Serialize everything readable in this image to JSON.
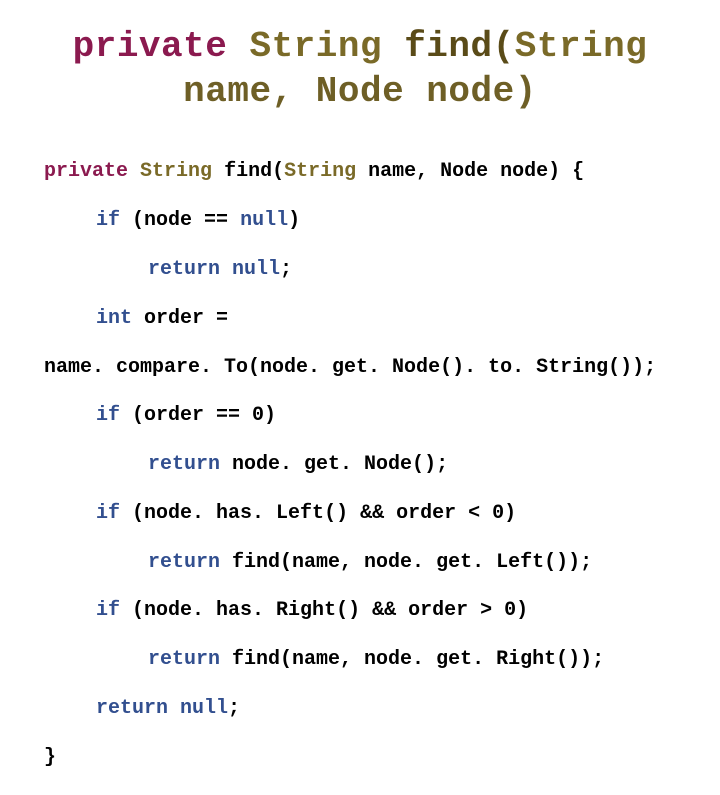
{
  "title": {
    "tok_private": "private",
    "tok_String1": "String",
    "tok_find": "find(",
    "tok_String2": "String",
    "tok_name_node": "name, Node node)"
  },
  "code": {
    "l1": {
      "private": "private",
      "sp1": " ",
      "String": "String",
      "sp2": " ",
      "find": "find(",
      "String2": "String",
      "rest": " name, Node node) {"
    },
    "l2": {
      "if": "if",
      "sp": " ",
      "open": "(node == ",
      "null": "null",
      "close": ")"
    },
    "l3": {
      "return": "return",
      "sp": " ",
      "null": "null",
      "semi": ";"
    },
    "l4": {
      "int": "int",
      "sp": " ",
      "rest": "order ="
    },
    "l5": {
      "text": "name. compare. To(node. get. Node(). to. String());"
    },
    "l6": {
      "if": "if",
      "sp": " ",
      "rest": "(order == 0)"
    },
    "l7": {
      "return": "return",
      "sp": " ",
      "rest": "node. get. Node();"
    },
    "l8": {
      "if": "if",
      "sp": " ",
      "rest": "(node. has. Left() && order < 0)"
    },
    "l9": {
      "return": "return",
      "sp": " ",
      "rest": "find(name, node. get. Left());"
    },
    "l10": {
      "if": "if",
      "sp": " ",
      "rest": "(node. has. Right() && order > 0)"
    },
    "l11": {
      "return": "return",
      "sp": " ",
      "rest": "find(name, node. get. Right());"
    },
    "l12": {
      "return": "return",
      "sp": " ",
      "null": "null",
      "semi": ";"
    },
    "l13": {
      "brace": "}"
    }
  }
}
